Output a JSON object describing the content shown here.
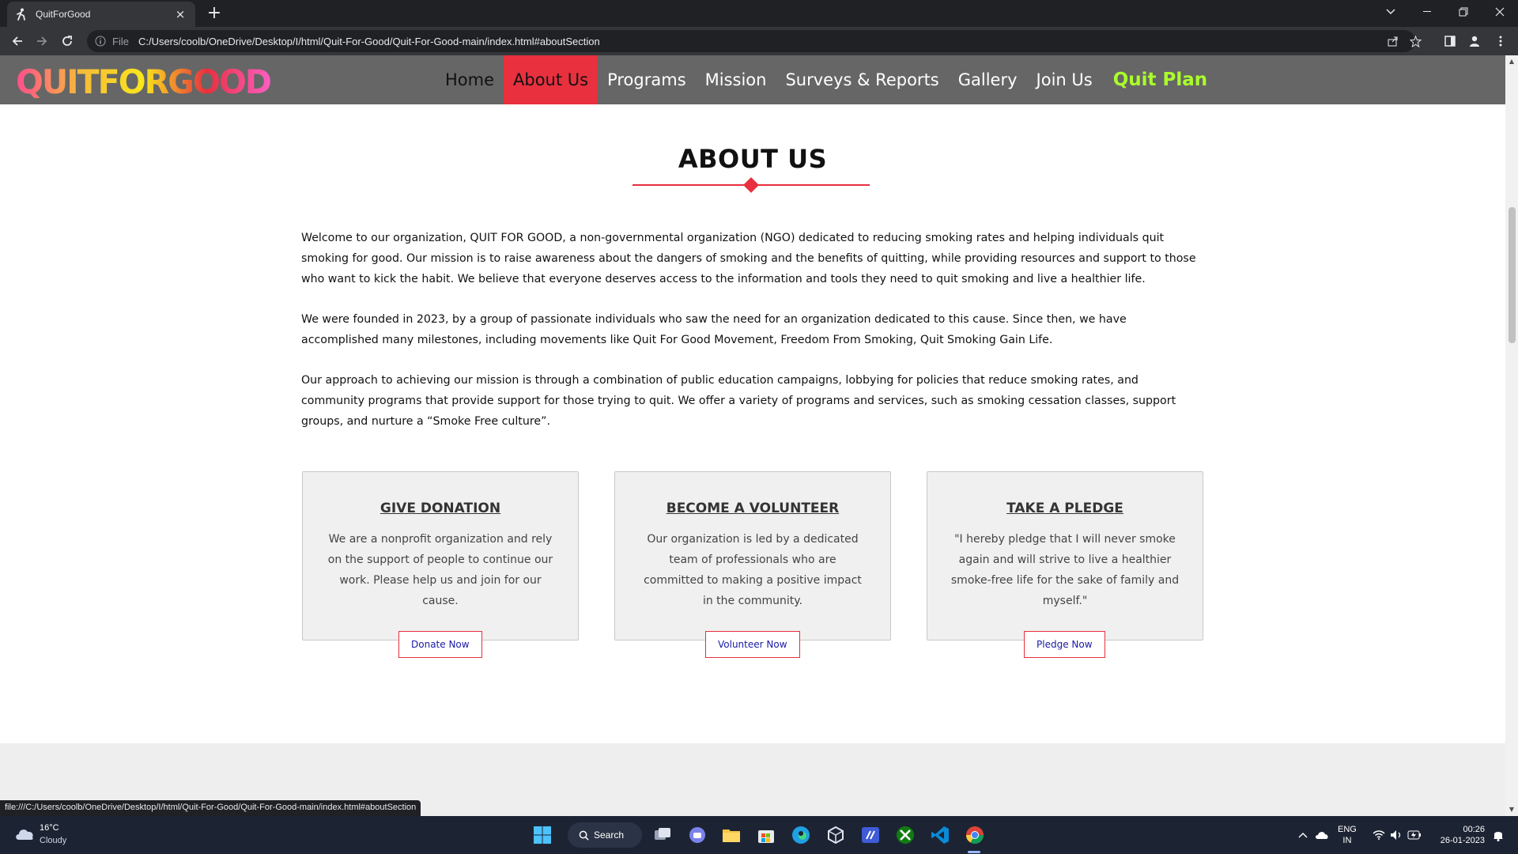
{
  "browser": {
    "tab_title": "QuitForGood",
    "tab_close": "×",
    "new_tab": "+",
    "file_label": "File",
    "url": "C:/Users/coolb/OneDrive/Desktop/I/html/Quit-For-Good/Quit-For-Good-main/index.html#aboutSection",
    "status_url": "file:///C:/Users/coolb/OneDrive/Desktop/I/html/Quit-For-Good/Quit-For-Good-main/index.html#aboutSection"
  },
  "site": {
    "logo_text": "QUITFORGOOD",
    "nav": [
      {
        "label": "Home"
      },
      {
        "label": "About Us"
      },
      {
        "label": "Programs"
      },
      {
        "label": "Mission"
      },
      {
        "label": "Surveys & Reports"
      },
      {
        "label": "Gallery"
      },
      {
        "label": "Join Us"
      },
      {
        "label": "Quit Plan"
      }
    ],
    "colors": {
      "accent": "#e8303e",
      "quit_plan": "#aaff2a",
      "header": "#666666"
    }
  },
  "about": {
    "title": "ABOUT US",
    "paragraphs": [
      "Welcome to our organization, QUIT FOR GOOD, a non-governmental organization (NGO) dedicated to reducing smoking rates and helping individuals quit smoking for good. Our mission is to raise awareness about the dangers of smoking and the benefits of quitting, while providing resources and support to those who want to kick the habit. We believe that everyone deserves access to the information and tools they need to quit smoking and live a healthier life.",
      "We were founded in 2023, by a group of passionate individuals who saw the need for an organization dedicated to this cause. Since then, we have accomplished many milestones, including movements like Quit For Good Movement, Freedom From Smoking, Quit Smoking Gain Life.",
      "Our approach to achieving our mission is through a combination of public education campaigns, lobbying for policies that reduce smoking rates, and community programs that provide support for those trying to quit. We offer a variety of programs and services, such as smoking cessation classes, support groups, and nurture a “Smoke Free culture”."
    ]
  },
  "cards": [
    {
      "title": "GIVE DONATION",
      "body": "We are a nonprofit organization and rely on the support of people to continue our work. Please help us and join for our cause.",
      "button": "Donate Now"
    },
    {
      "title": "BECOME A VOLUNTEER",
      "body": "Our organization is led by a dedicated team of professionals who are committed to making a positive impact in the community.",
      "button": "Volunteer Now"
    },
    {
      "title": "TAKE A PLEDGE",
      "body": "\"I hereby pledge that I will never smoke again and will strive to live a healthier smoke-free life for the sake of family and myself.\"",
      "button": "Pledge Now"
    }
  ],
  "taskbar": {
    "weather_temp": "16°C",
    "weather_desc": "Cloudy",
    "search_label": "Search",
    "lang_line1": "ENG",
    "lang_line2": "IN",
    "time": "00:26",
    "date": "26-01-2023"
  }
}
